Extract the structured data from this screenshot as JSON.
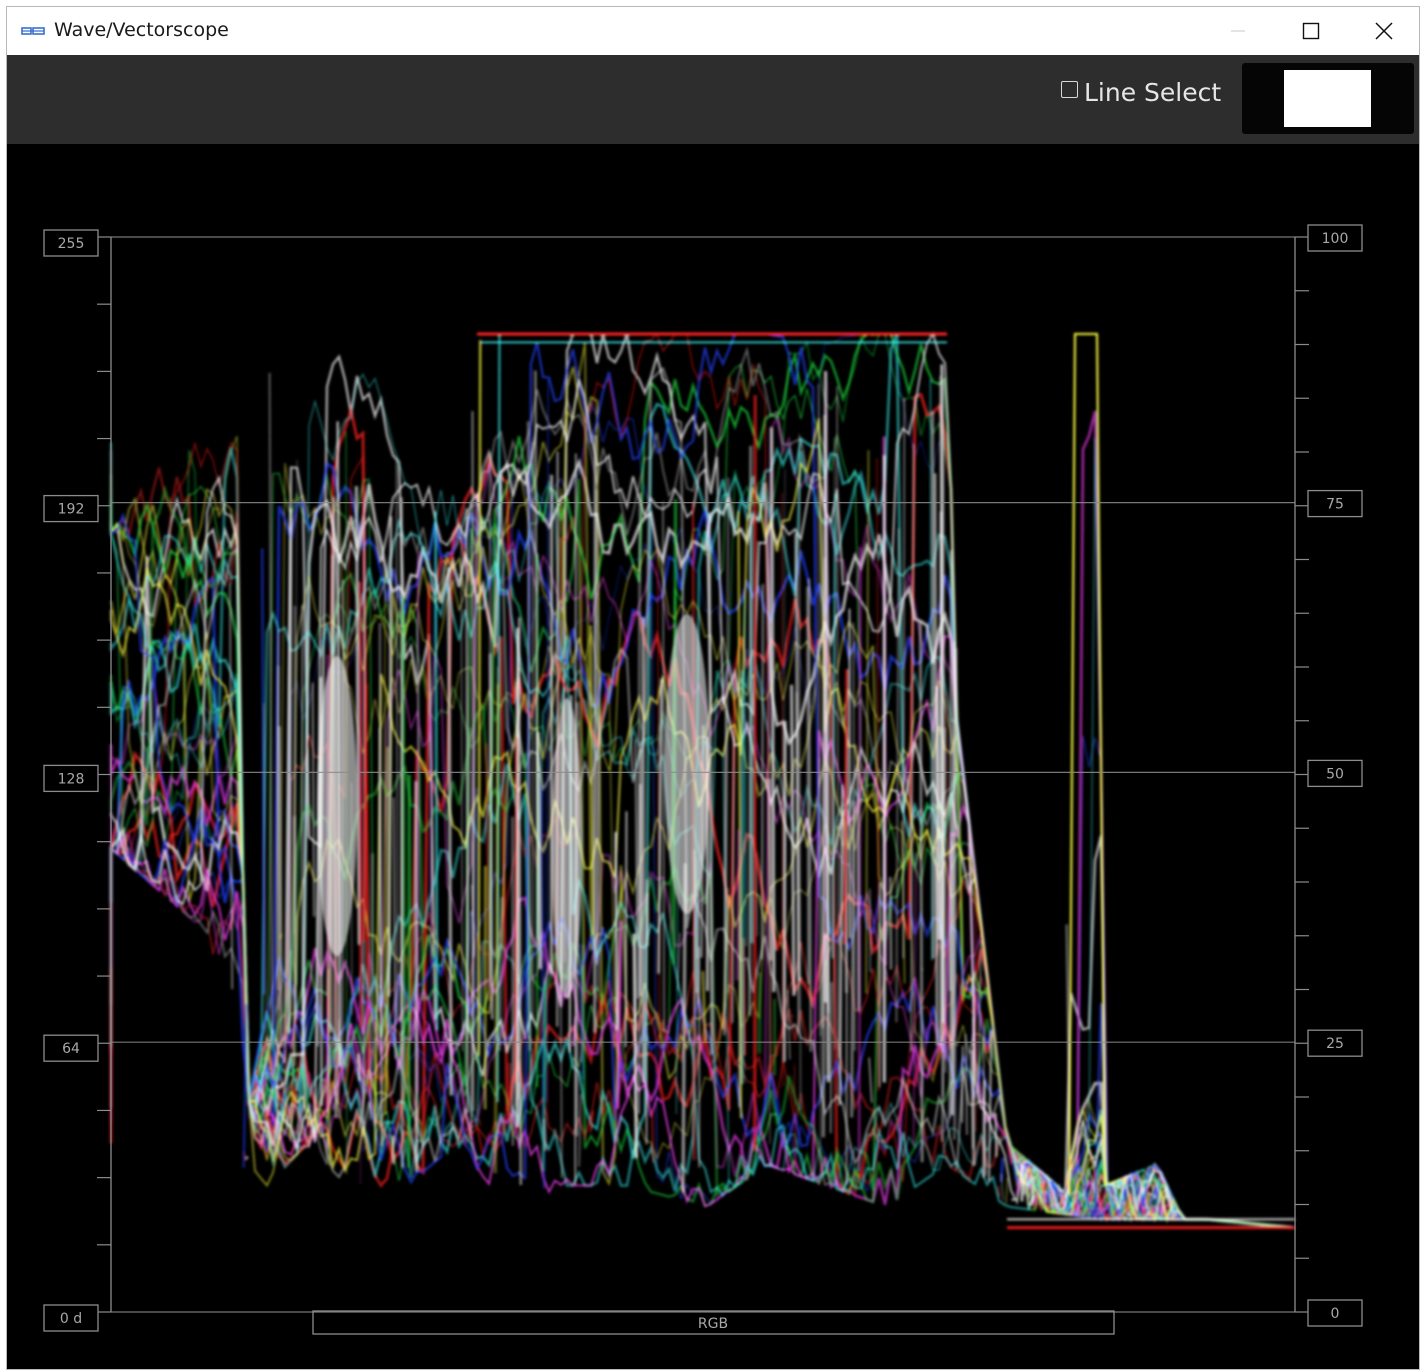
{
  "window": {
    "title": "Wave/Vectorscope",
    "app_icon": "scope-app-icon",
    "controls": {
      "minimize": "minimize-icon",
      "maximize": "maximize-icon",
      "close": "close-icon"
    }
  },
  "toolbar": {
    "line_select": {
      "label": "Line Select",
      "checked": false
    },
    "preview_color": "#ffffff"
  },
  "scope": {
    "mode_label": "RGB",
    "left_scale": [
      "255",
      "192",
      "128",
      "64",
      "0 d"
    ],
    "right_scale": [
      "100",
      "75",
      "50",
      "25",
      "0"
    ],
    "colors": {
      "background": "#000000",
      "graticule": "#8c8c8c",
      "red": "#ff2020",
      "green": "#20e040",
      "blue": "#2040ff",
      "white": "#ffffff"
    }
  }
}
